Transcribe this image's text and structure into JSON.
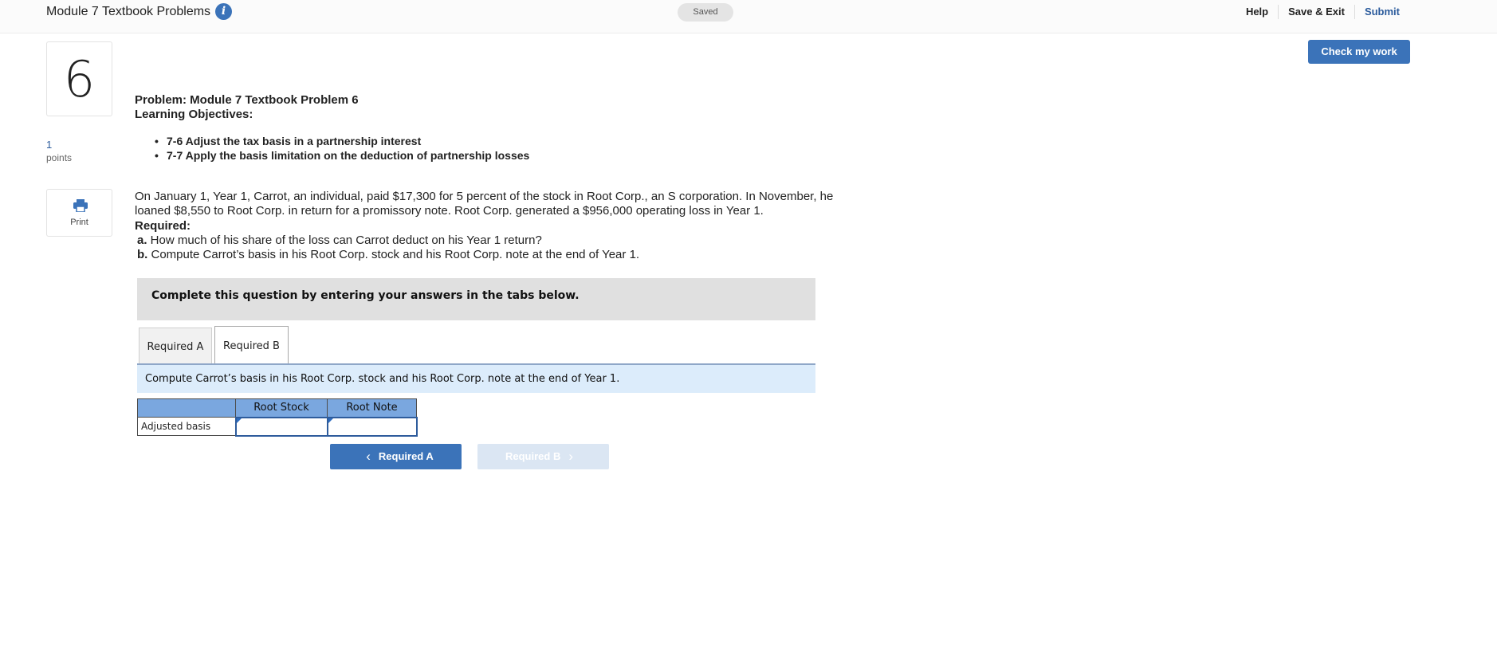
{
  "header": {
    "title": "Module 7 Textbook Problems",
    "info_icon": "i",
    "saved_label": "Saved",
    "help_label": "Help",
    "save_exit_label": "Save & Exit",
    "submit_label": "Submit"
  },
  "check_button_label": "Check my work",
  "question": {
    "number": "6",
    "points_value": "1",
    "points_label": "points",
    "print_label": "Print"
  },
  "problem": {
    "title": "Problem: Module 7 Textbook Problem 6",
    "learning_objectives_label": "Learning Objectives:",
    "objectives": [
      "7-6 Adjust the tax basis in a partnership interest",
      "7-7 Apply the basis limitation on the deduction of partnership losses"
    ],
    "body_line1": "On January 1, Year 1, Carrot, an individual, paid $17,300 for 5 percent of the stock in Root Corp., an S corporation. In November, he",
    "body_line2": "loaned $8,550 to Root Corp. in return for a promissory note. Root Corp. generated a $956,000 operating loss in Year 1.",
    "required_label": "Required:",
    "part_a_letter": "a.",
    "part_a_text": " How much of his share of the loss can Carrot deduct on his Year 1 return?",
    "part_b_letter": "b.",
    "part_b_text": " Compute Carrot’s basis in his Root Corp. stock and his Root Corp. note at the end of Year 1."
  },
  "instructions": "Complete this question by entering your answers in the tabs below.",
  "tabs": [
    {
      "label": "Required A"
    },
    {
      "label": "Required B"
    }
  ],
  "tab_description": "Compute Carrot’s basis in his Root Corp. stock and his Root Corp. note at the end of Year 1.",
  "table": {
    "headers": [
      "Root Stock",
      "Root Note"
    ],
    "row_label": "Adjusted basis",
    "values": [
      "",
      ""
    ]
  },
  "nav": {
    "prev_label": "Required A",
    "next_label": "Required B"
  },
  "colors": {
    "accent": "#3b73b9",
    "table_header": "#7aa7df",
    "tab_description_bg": "#dcecfb",
    "disabled_button": "#dbe6f3"
  }
}
